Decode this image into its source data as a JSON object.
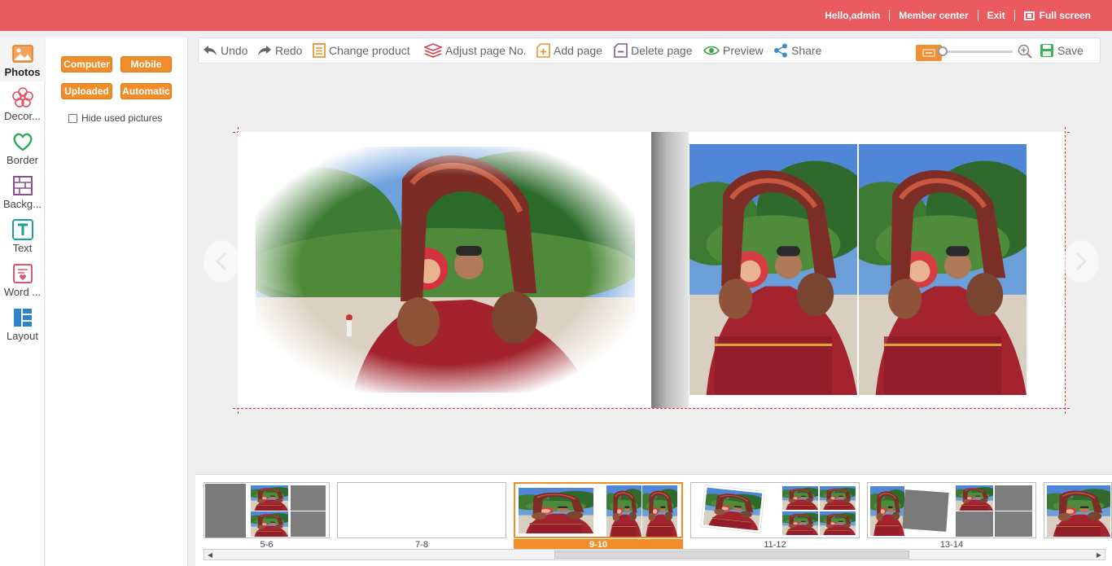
{
  "topbar": {
    "greeting": "Hello,admin",
    "member_center": "Member center",
    "exit": "Exit",
    "full_screen": "Full screen",
    "bg_color": "#e95b5f"
  },
  "rail": {
    "items": [
      {
        "label": "Photos",
        "icon": "photo-icon"
      },
      {
        "label": "Decor...",
        "icon": "flower-icon"
      },
      {
        "label": "Border",
        "icon": "heart-icon"
      },
      {
        "label": "Backg...",
        "icon": "background-grid-icon"
      },
      {
        "label": "Text",
        "icon": "text-t-icon"
      },
      {
        "label": "Word ...",
        "icon": "word-art-icon"
      },
      {
        "label": "Layout",
        "icon": "layout-icon"
      }
    ]
  },
  "panel": {
    "buttons": [
      "Computer",
      "Mobile",
      "Uploaded",
      "Automatic"
    ],
    "hide_used_label": "Hide used pictures",
    "hide_used_checked": false,
    "accent": "#f08d2a"
  },
  "toolbar": {
    "undo": "Undo",
    "redo": "Redo",
    "change_product": "Change  product",
    "adjust_page": "Adjust page No.",
    "add_page": "Add page",
    "delete_page": "Delete page",
    "preview": "Preview",
    "share": "Share",
    "save": "Save",
    "zoom_level": 0.0
  },
  "canvas": {
    "left_page_photo": "beach-couple-photo-vignette",
    "right_page_photos": [
      "couple-photo-1",
      "couple-photo-2"
    ]
  },
  "thumbnails": [
    {
      "label": "5-6",
      "active": false
    },
    {
      "label": "7-8",
      "active": false
    },
    {
      "label": "9-10",
      "active": true
    },
    {
      "label": "11-12",
      "active": false
    },
    {
      "label": "13-14",
      "active": false
    },
    {
      "label": "",
      "active": false
    }
  ]
}
